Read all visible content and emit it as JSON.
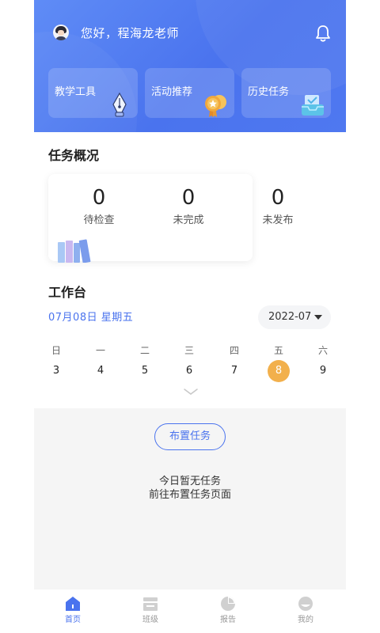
{
  "header": {
    "greeting": "您好，程海龙老师",
    "tools": [
      {
        "label": "教学工具",
        "icon": "pen-nib-icon"
      },
      {
        "label": "活动推荐",
        "icon": "medal-icon"
      },
      {
        "label": "历史任务",
        "icon": "inbox-tray-icon"
      }
    ]
  },
  "overview": {
    "title": "任务概况",
    "stats": [
      {
        "value": "0",
        "label": "待检查"
      },
      {
        "value": "0",
        "label": "未完成"
      },
      {
        "value": "0",
        "label": "未发布"
      }
    ]
  },
  "workbench": {
    "title": "工作台",
    "date": "07月08日 星期五",
    "month": "2022-07",
    "weekdays": [
      "日",
      "一",
      "二",
      "三",
      "四",
      "五",
      "六"
    ],
    "days": [
      "3",
      "4",
      "5",
      "6",
      "7",
      "8",
      "9"
    ],
    "today": "8"
  },
  "empty_state": {
    "button": "布置任务",
    "line1": "今日暂无任务",
    "line2": "前往布置任务页面"
  },
  "nav": {
    "items": [
      {
        "label": "首页",
        "icon": "home-icon",
        "active": true
      },
      {
        "label": "班级",
        "icon": "class-icon",
        "active": false
      },
      {
        "label": "报告",
        "icon": "report-pie-icon",
        "active": false
      },
      {
        "label": "我的",
        "icon": "profile-icon",
        "active": false
      }
    ]
  },
  "colors": {
    "primary": "#4a73ee",
    "today": "#f2b04c",
    "header_gradient_start": "#5f8cf6",
    "header_gradient_end": "#4a73ee"
  }
}
